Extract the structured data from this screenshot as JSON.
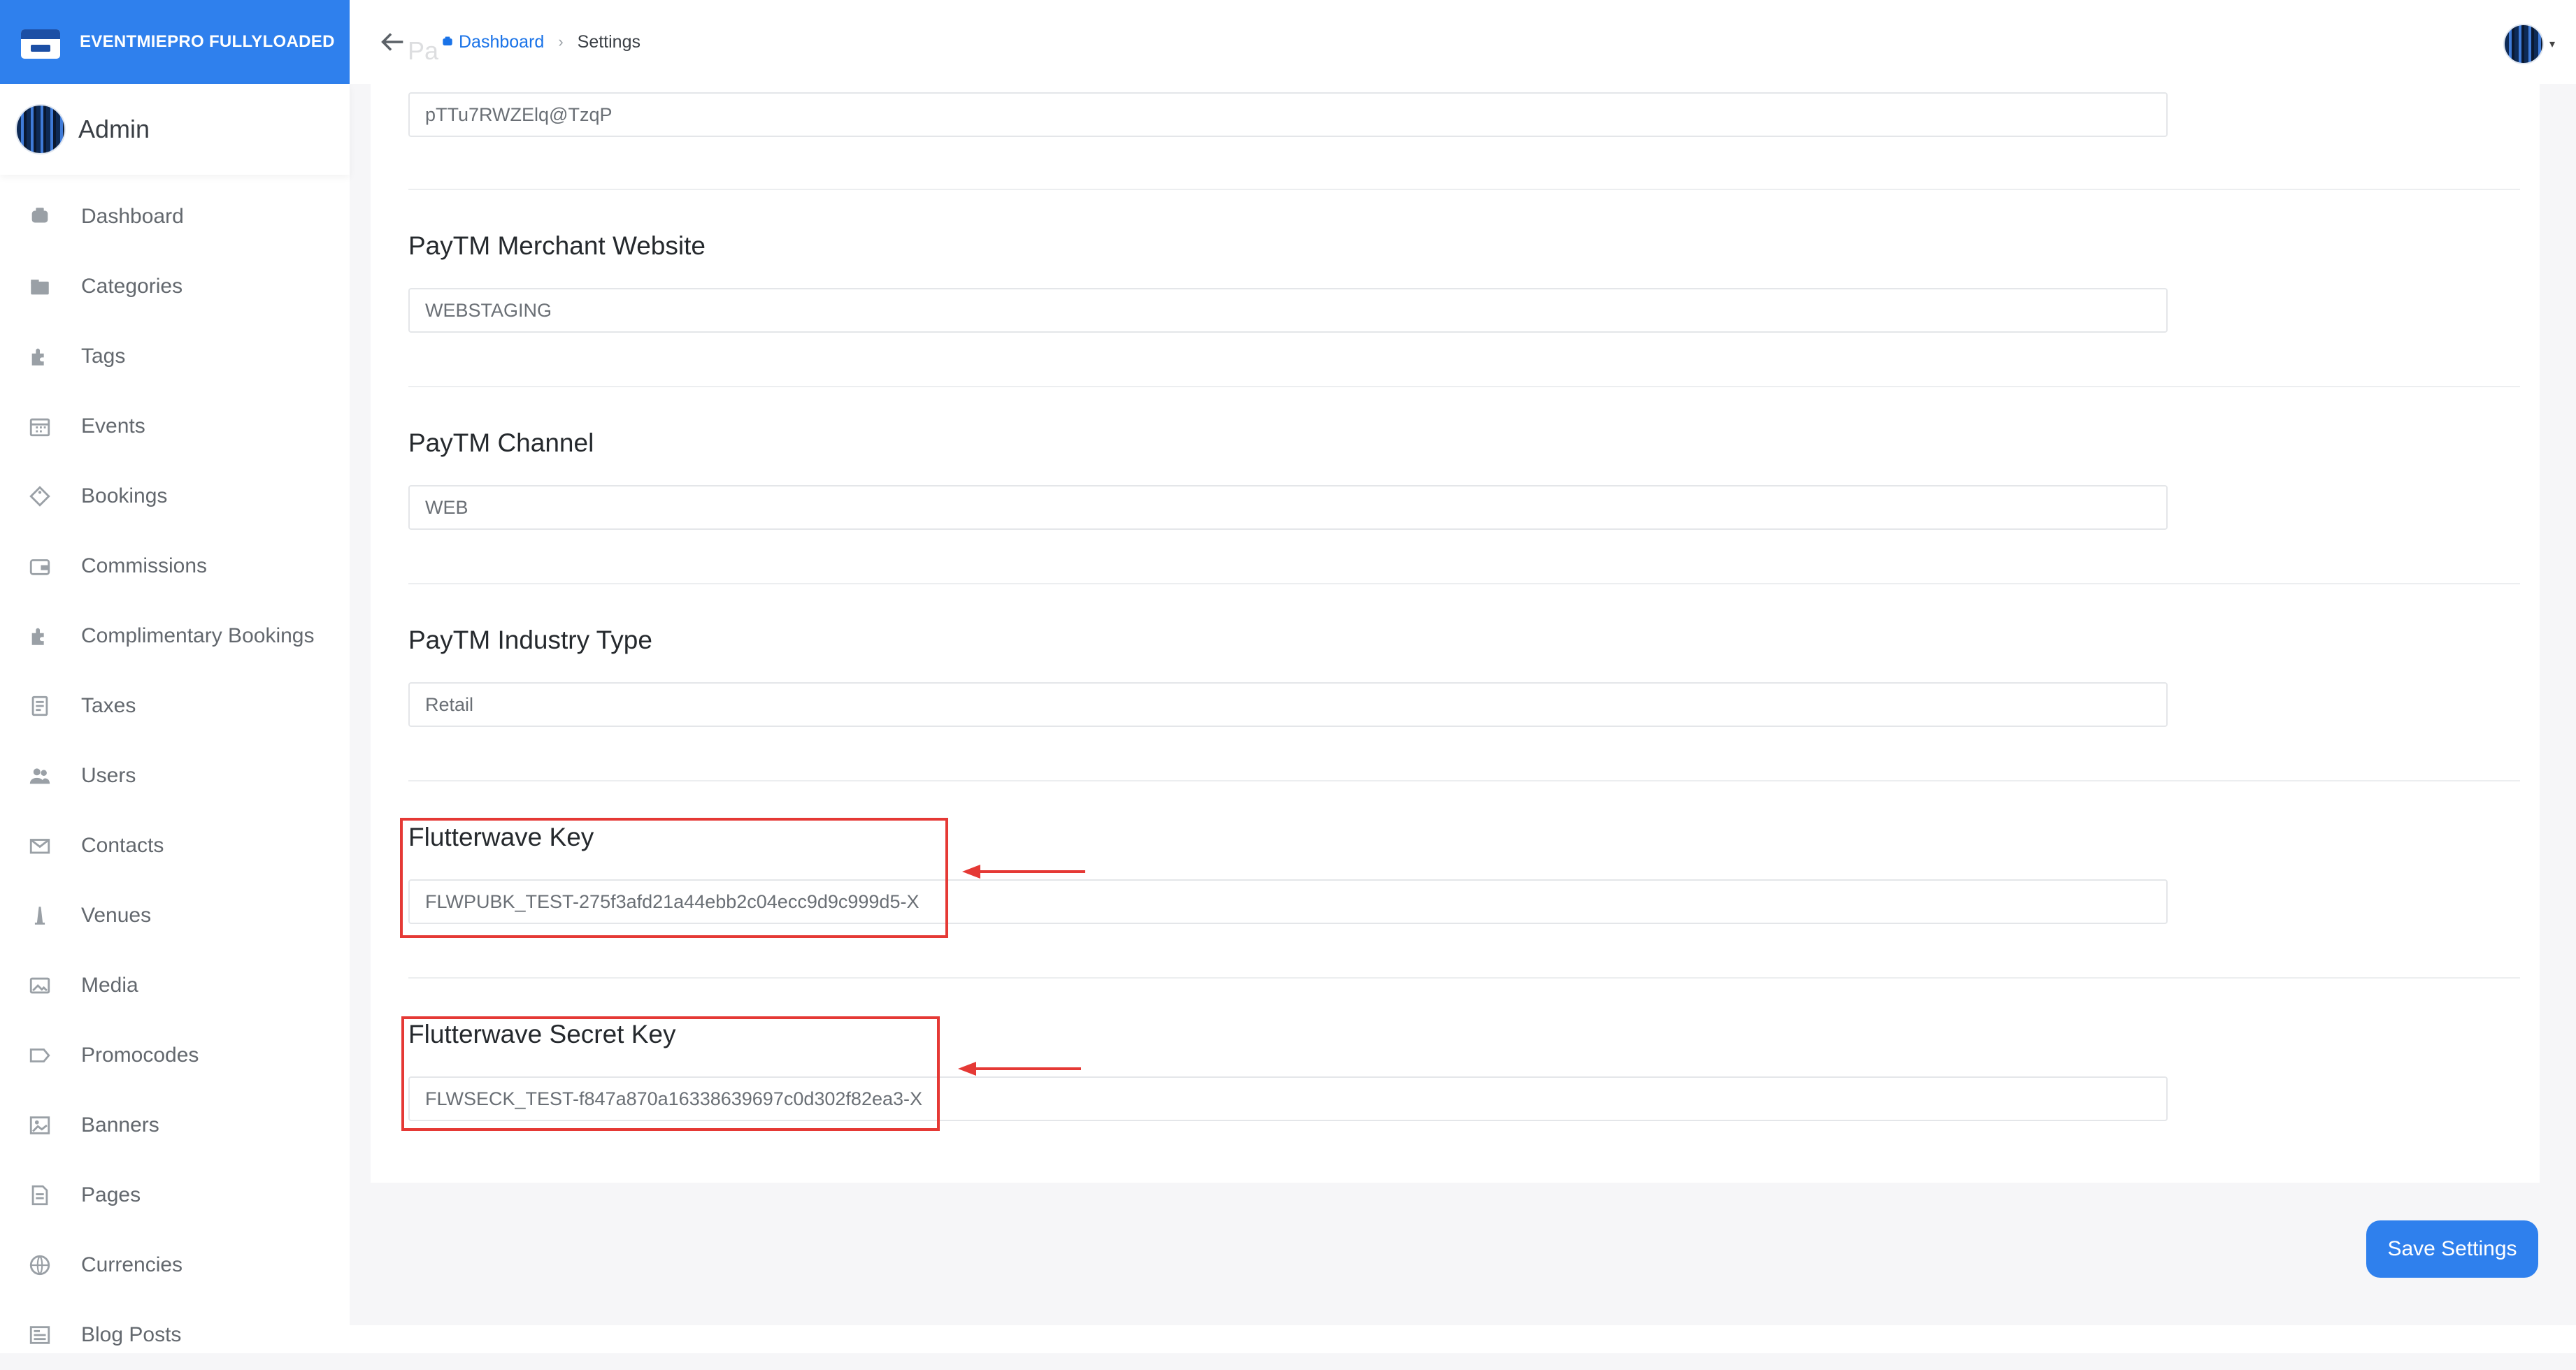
{
  "brand": {
    "name": "EVENTMIEPRO FULLYLOADED",
    "color": "#2f80ed"
  },
  "admin": {
    "name": "Admin"
  },
  "sidebar": {
    "items": [
      {
        "label": "Dashboard",
        "icon": "dashboard-icon"
      },
      {
        "label": "Categories",
        "icon": "folder-icon"
      },
      {
        "label": "Tags",
        "icon": "puzzle-icon"
      },
      {
        "label": "Events",
        "icon": "calendar-icon"
      },
      {
        "label": "Bookings",
        "icon": "ticket-icon"
      },
      {
        "label": "Commissions",
        "icon": "wallet-icon"
      },
      {
        "label": "Complimentary Bookings",
        "icon": "puzzle-icon"
      },
      {
        "label": "Taxes",
        "icon": "receipt-icon"
      },
      {
        "label": "Users",
        "icon": "users-icon"
      },
      {
        "label": "Contacts",
        "icon": "envelope-icon"
      },
      {
        "label": "Venues",
        "icon": "tower-icon"
      },
      {
        "label": "Media",
        "icon": "image-icon"
      },
      {
        "label": "Promocodes",
        "icon": "tag-icon"
      },
      {
        "label": "Banners",
        "icon": "picture-icon"
      },
      {
        "label": "Pages",
        "icon": "document-icon"
      },
      {
        "label": "Currencies",
        "icon": "globe-icon"
      },
      {
        "label": "Blog Posts",
        "icon": "newspaper-icon"
      }
    ]
  },
  "breadcrumb": {
    "home": "Dashboard",
    "current": "Settings"
  },
  "form": {
    "partial_label": "Pa",
    "first_value": "pTTu7RWZElq@TzqP",
    "fields": [
      {
        "label": "PayTM Merchant Website",
        "value": "WEBSTAGING"
      },
      {
        "label": "PayTM Channel",
        "value": "WEB"
      },
      {
        "label": "PayTM Industry Type",
        "value": "Retail"
      },
      {
        "label": "Flutterwave Key",
        "value": "FLWPUBK_TEST-275f3afd21a44ebb2c04ecc9d9c999d5-X"
      },
      {
        "label": "Flutterwave Secret Key",
        "value": "FLWSECK_TEST-f847a870a16338639697c0d302f82ea3-X"
      }
    ]
  },
  "actions": {
    "save_label": "Save Settings"
  },
  "annotation_color": "#e53935"
}
